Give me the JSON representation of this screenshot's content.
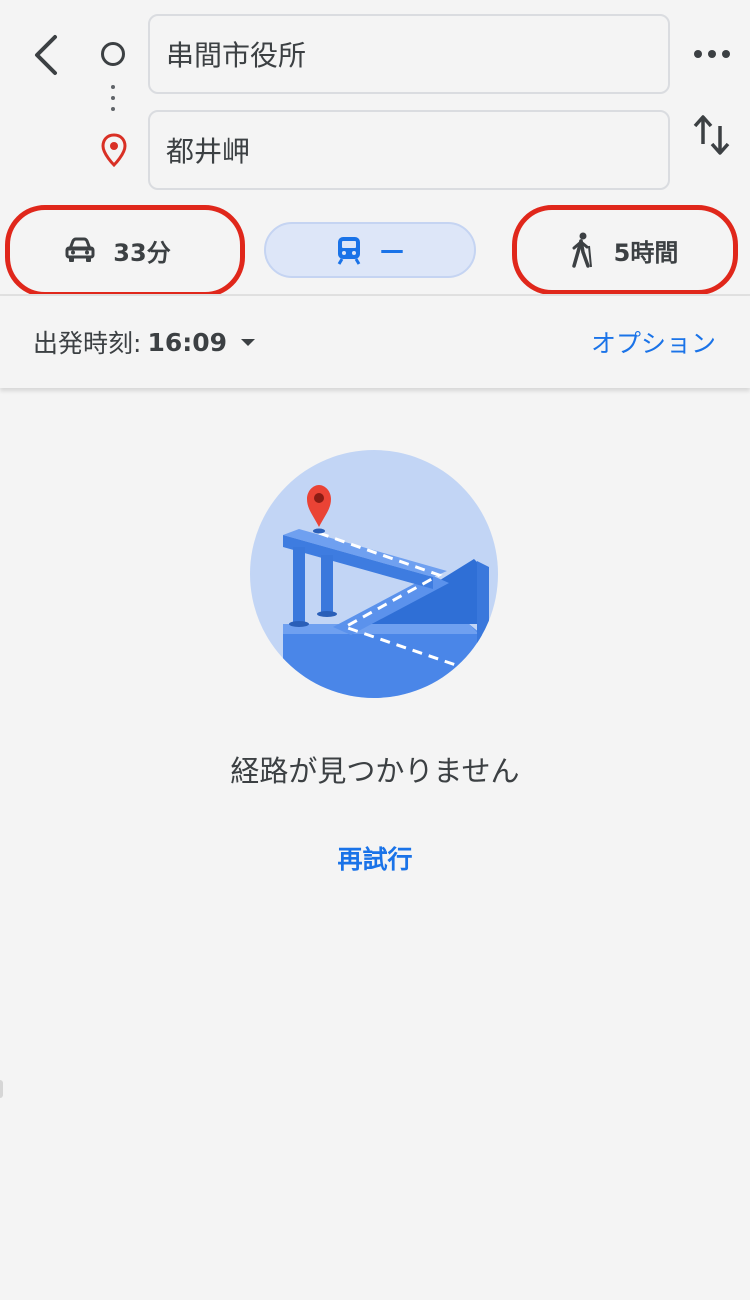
{
  "search": {
    "origin_value": "串間市役所",
    "destination_value": "都井岬"
  },
  "modes": {
    "car_time": "33分",
    "transit_time": "—",
    "walk_time": "5時間"
  },
  "departure": {
    "label": "出発時刻:",
    "time": "16:09"
  },
  "options_label": "オプション",
  "message": {
    "no_route": "経路が見つかりません",
    "retry": "再試行"
  },
  "colors": {
    "accent": "#1a73e8",
    "highlight_ring": "#e0271b",
    "pin": "#d93025"
  },
  "icons": [
    "back-arrow-icon",
    "origin-circle-icon",
    "route-dots-icon",
    "destination-pin-icon",
    "more-icon",
    "swap-icon",
    "car-icon",
    "train-icon",
    "walk-icon",
    "dropdown-caret-icon"
  ]
}
